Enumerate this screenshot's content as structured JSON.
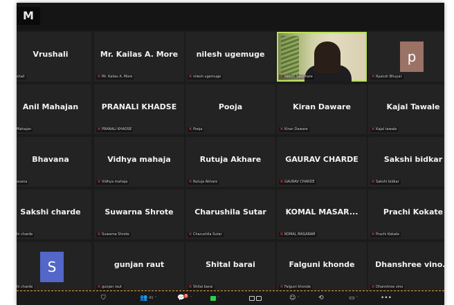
{
  "window": {
    "corner_logo": "M"
  },
  "tiles": [
    [
      {
        "name": "Vrushali",
        "label": "shali"
      },
      {
        "name": "Mr. Kailas A. More",
        "label": "Mr. Kailas A. More"
      },
      {
        "name": "nilesh ugemuge",
        "label": "nilesh ugemuge"
      },
      {
        "name": "",
        "label": "Nilesh Sandhare",
        "video": true
      },
      {
        "name": "",
        "label": "Ryansh Bhuyar",
        "avatar": "p"
      }
    ],
    [
      {
        "name": "Anil Mahajan",
        "label": "Mahajan"
      },
      {
        "name": "PRANALI KHADSE",
        "label": "PRANALI KHADSE"
      },
      {
        "name": "Pooja",
        "label": "Pooja"
      },
      {
        "name": "Kiran Daware",
        "label": "Kiran Daware"
      },
      {
        "name": "Kajal Tawale",
        "label": "Kajal tawale"
      }
    ],
    [
      {
        "name": "Bhavana",
        "label": "avana"
      },
      {
        "name": "Vidhya mahaja",
        "label": "Vidhya mahaja"
      },
      {
        "name": "Rutuja Akhare",
        "label": "Rutuja Akhare"
      },
      {
        "name": "GAURAV CHARDE",
        "label": "GAURAV CHARDE"
      },
      {
        "name": "Sakshi  bidkar",
        "label": "Sakshi bidkar"
      }
    ],
    [
      {
        "name": "Sakshi charde",
        "label": "hi charde"
      },
      {
        "name": "Suwarna Shrote",
        "label": "Suwarna Shrote"
      },
      {
        "name": "Charushila Sutar",
        "label": "Charushila Sutar"
      },
      {
        "name": "KOMAL MASAR...",
        "label": "KOMAL MASARAM"
      },
      {
        "name": "Prachi Kokate",
        "label": "Prachi Kokate"
      }
    ],
    [
      {
        "name": "",
        "label": "hi charde",
        "avatar": "S"
      },
      {
        "name": "gunjan raut",
        "label": "gunjan raut"
      },
      {
        "name": "Shital barai",
        "label": "Shital barai"
      },
      {
        "name": "Falguni khonde",
        "label": "Falguni khonde"
      },
      {
        "name": "Dhanshree  vino...",
        "label": "Dhanshree vino"
      }
    ]
  ],
  "toolbar": {
    "participants_count": "41",
    "chat_badge": "8"
  },
  "colors": {
    "active_speaker_border": "#b9e05a",
    "mic_muted": "#e2443c",
    "avatar_p": "#9b7266",
    "avatar_s": "#5267c9",
    "video_on": "#2ed04b"
  }
}
